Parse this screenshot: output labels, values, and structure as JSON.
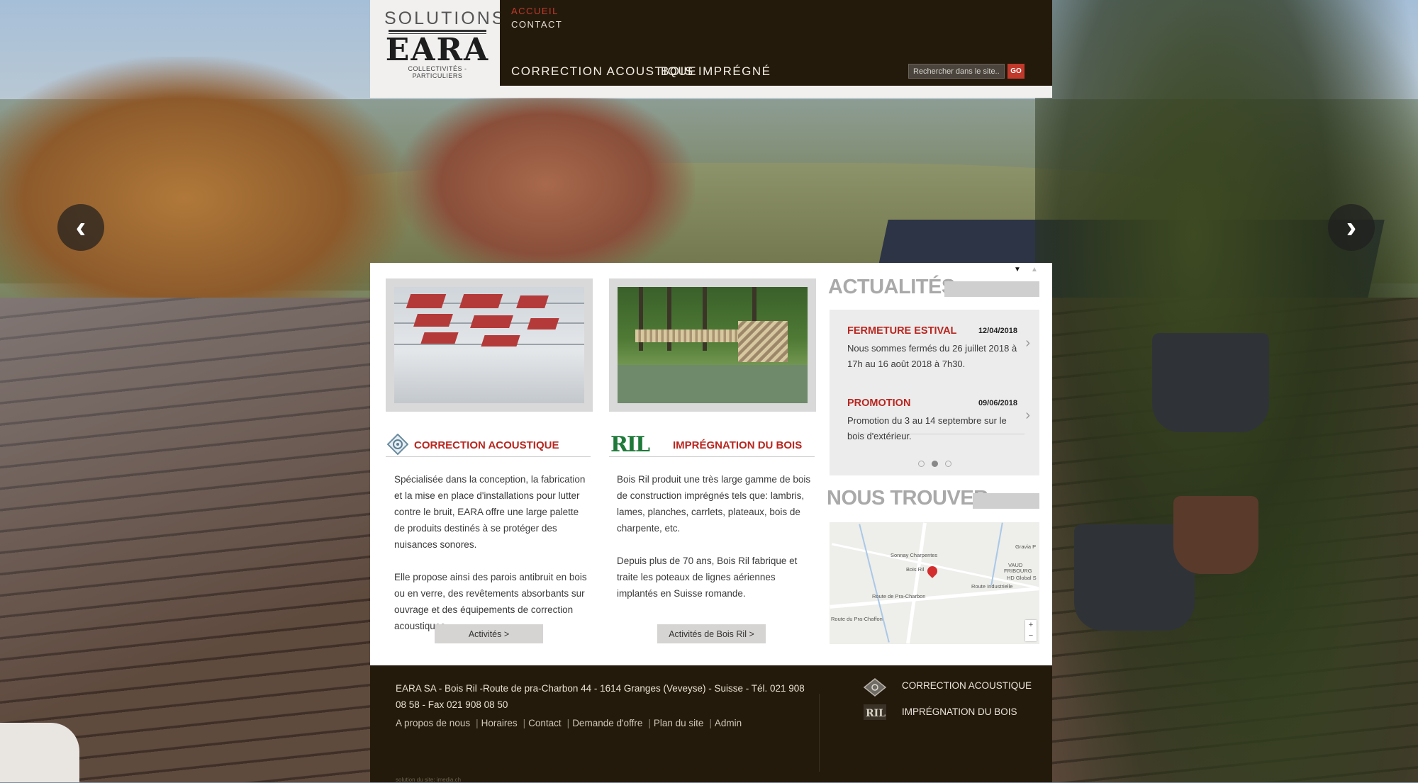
{
  "header": {
    "logo": {
      "top": "SOLUTIONS",
      "brand": "EARA",
      "tagline": "COLLECTIVITÉS - PARTICULIERS"
    },
    "top_links": [
      "ACCUEIL",
      "CONTACT"
    ],
    "main_links": [
      "CORRECTION ACOUSTIQUE",
      "BOIS IMPRÉGNÉ"
    ],
    "search": {
      "placeholder": "Rechercher dans le site...",
      "button": "GO"
    }
  },
  "slider": {
    "prev": "‹",
    "next": "›"
  },
  "cards": [
    {
      "title": "CORRECTION ACOUSTIQUE",
      "paragraphs": [
        "Spécialisée dans la conception, la fabrication et la mise en place d'installations pour lutter contre le bruit, EARA offre une large palette de produits destinés à se protéger des nuisances sonores.",
        "Elle propose ainsi des parois antibruit en bois ou en verre, des revêtements absorbants sur ouvrage et des équipements de correction acoustiques."
      ],
      "button": "Activités >"
    },
    {
      "title": "IMPRÉGNATION DU BOIS",
      "logo_text": "RIL",
      "paragraphs": [
        "Bois Ril produit une très large gamme de bois de construction imprégnés tels que: lambris, lames, planches, carrlets, plateaux, bois de charpente, etc.",
        "Depuis plus de 70 ans, Bois Ril fabrique et traite les poteaux de lignes aériennes implantés en Suisse romande."
      ],
      "button": "Activités de Bois Ril >"
    }
  ],
  "news": {
    "title": "ACTUALITÉS",
    "items": [
      {
        "title": "FERMETURE ESTIVAL",
        "date": "12/04/2018",
        "text": "Nous sommes fermés du 26 juillet 2018 à 17h au 16 août 2018 à 7h30."
      },
      {
        "title": "PROMOTION",
        "date": "09/06/2018",
        "text": "Promotion du 3 au 14 septembre sur le bois d'extérieur."
      }
    ],
    "active_dot": 2
  },
  "find_us": {
    "title": "NOUS TROUVER",
    "map_labels": [
      "Sonnay Charpentes",
      "Bois Ril",
      "Gravia P",
      "VAUD",
      "FRIBOURG",
      "HD Global S",
      "Route de Pra-Charbon",
      "Route Industrielle",
      "Route du Pra-Chaffon"
    ]
  },
  "footer": {
    "address": "EARA SA - Bois Ril -Route de pra-Charbon 44 - 1614 Granges (Veveyse) - Suisse - Tél. 021 908 08 58 - Fax 021 908 08 50",
    "links": [
      "A propos de nous",
      "Horaires",
      "Contact",
      "Demande d'offre",
      "Plan du site",
      "Admin"
    ],
    "side_links": [
      "CORRECTION ACOUSTIQUE",
      "IMPRÉGNATION DU BOIS"
    ],
    "credit": "solution du site: imedia.ch"
  }
}
